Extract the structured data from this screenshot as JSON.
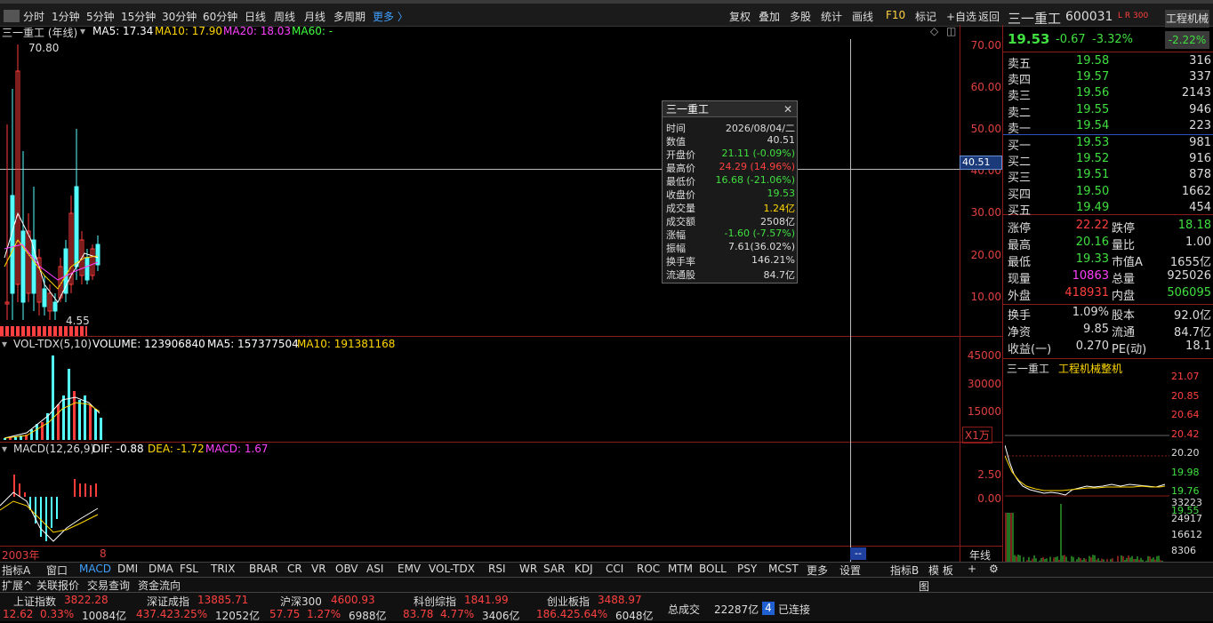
{
  "menu": {
    "periods": [
      "分时",
      "1分钟",
      "5分钟",
      "15分钟",
      "30分钟",
      "60分钟",
      "日线",
      "周线",
      "月线",
      "多周期",
      "更多 〉"
    ],
    "actions": [
      "复权",
      "叠加",
      "多股",
      "统计",
      "画线",
      "F10",
      "标记",
      "+自选",
      "返回"
    ]
  },
  "chart": {
    "title": "三一重工 (年线)",
    "ma_legend": [
      {
        "label": "MA5: 17.34",
        "color": "#ffffff"
      },
      {
        "label": "MA10: 17.90",
        "color": "#ffd700"
      },
      {
        "label": "MA20: 18.03",
        "color": "#ff40ff"
      },
      {
        "label": "MA60: -",
        "color": "#40ff40"
      }
    ],
    "high_label": "70.80",
    "low_label": "4.55",
    "y_ticks": [
      "70.00",
      "60.00",
      "50.00",
      "40.00",
      "30.00",
      "20.00",
      "10.00"
    ],
    "crosshair_value": "40.51",
    "vol_legend": {
      "name": "VOL-TDX(5,10)",
      "volume": "VOLUME: 123906840",
      "ma5": "MA5: 157377504",
      "ma10": "MA10: 191381168"
    },
    "vol_ticks": [
      "45000",
      "30000",
      "15000"
    ],
    "vol_unit": "X1万",
    "macd_legend": {
      "name": "MACD(12,26,9)",
      "dif": "DIF: -0.88",
      "dea": "DEA: -1.72",
      "macd": "MACD: 1.67"
    },
    "macd_ticks": [
      "2.50",
      "0.00"
    ],
    "x_start": "2003年",
    "x_mark": "8",
    "period_label": "年线",
    "cursor_box": "--",
    "colors": {
      "up": "#ff3c3c",
      "down": "#54ffff",
      "grid": "#8b1a1a"
    }
  },
  "tooltip": {
    "title": "三一重工",
    "rows": [
      {
        "k": "时间",
        "v": "2026/08/04/二",
        "c": "#dddddd"
      },
      {
        "k": "数值",
        "v": "40.51",
        "c": "#dddddd"
      },
      {
        "k": "开盘价",
        "v": "21.11 (-0.09%)",
        "c": "#40e040"
      },
      {
        "k": "最高价",
        "v": "24.29 (14.96%)",
        "c": "#ff4040"
      },
      {
        "k": "最低价",
        "v": "16.68 (-21.06%)",
        "c": "#40e040"
      },
      {
        "k": "收盘价",
        "v": "19.53",
        "c": "#40e040"
      },
      {
        "k": "成交量",
        "v": "1.24亿",
        "c": "#ffd700"
      },
      {
        "k": "成交额",
        "v": "2508亿",
        "c": "#dddddd"
      },
      {
        "k": "涨幅",
        "v": "-1.60 (-7.57%)",
        "c": "#40e040"
      },
      {
        "k": "振幅",
        "v": "7.61(36.02%)",
        "c": "#dddddd"
      },
      {
        "k": "换手率",
        "v": "146.21%",
        "c": "#dddddd"
      },
      {
        "k": "流通股",
        "v": "84.7亿",
        "c": "#dddddd"
      }
    ]
  },
  "quote": {
    "name": "三一重工",
    "code": "600031",
    "tag": "L R 300",
    "sector": "工程机械",
    "sector_chg": "-2.22%",
    "price": "19.53",
    "chg": "-0.67",
    "pct": "-3.32%",
    "asks": [
      {
        "l": "卖五",
        "p": "19.58",
        "q": "316"
      },
      {
        "l": "卖四",
        "p": "19.57",
        "q": "337"
      },
      {
        "l": "卖三",
        "p": "19.56",
        "q": "2143"
      },
      {
        "l": "卖二",
        "p": "19.55",
        "q": "946"
      },
      {
        "l": "卖一",
        "p": "19.54",
        "q": "223"
      }
    ],
    "bids": [
      {
        "l": "买一",
        "p": "19.53",
        "q": "981"
      },
      {
        "l": "买二",
        "p": "19.52",
        "q": "916"
      },
      {
        "l": "买三",
        "p": "19.51",
        "q": "878"
      },
      {
        "l": "买四",
        "p": "19.50",
        "q": "1662"
      },
      {
        "l": "买五",
        "p": "19.49",
        "q": "454"
      }
    ],
    "stats": [
      {
        "a": "涨停",
        "av": "22.22",
        "ac": "#ff4040",
        "b": "跌停",
        "bv": "18.18",
        "bc": "#40e040"
      },
      {
        "a": "最高",
        "av": "20.16",
        "ac": "#40e040",
        "b": "量比",
        "bv": "1.00",
        "bc": "#dddddd"
      },
      {
        "a": "最低",
        "av": "19.33",
        "ac": "#40e040",
        "b": "市值A",
        "bv": "1655亿",
        "bc": "#dddddd"
      },
      {
        "a": "现量",
        "av": "10863",
        "ac": "#ff40ff",
        "b": "总量",
        "bv": "925026",
        "bc": "#dddddd"
      },
      {
        "a": "外盘",
        "av": "418931",
        "ac": "#ff4040",
        "b": "内盘",
        "bv": "506095",
        "bc": "#40e040"
      }
    ],
    "fund": [
      {
        "a": "换手",
        "av": "1.09%",
        "b": "股本",
        "bv": "92.0亿"
      },
      {
        "a": "净资",
        "av": "9.85",
        "b": "流通",
        "bv": "84.7亿"
      },
      {
        "a": "收益(一)",
        "av": "0.270",
        "b": "PE(动)",
        "bv": "18.1"
      }
    ],
    "mini_title": "三一重工",
    "mini_sector": "工程机械整机",
    "mini_ticks": [
      "21.07",
      "20.85",
      "20.64",
      "20.42",
      "20.20",
      "19.98",
      "19.76",
      "19.55"
    ],
    "mini_vol_ticks": [
      "33223",
      "24917",
      "16612",
      "8306"
    ]
  },
  "tabs": [
    "指标A",
    "窗口",
    "MACD",
    "DMI",
    "DMA",
    "FSL",
    "TRIX",
    "BRAR",
    "CR",
    "VR",
    "OBV",
    "ASI",
    "EMV",
    "VOL-TDX",
    "RSI",
    "WR",
    "SAR",
    "KDJ",
    "CCI",
    "ROC",
    "MTM",
    "BOLL",
    "PSY",
    "MCST",
    "更多",
    "设置"
  ],
  "tabs_right": [
    "指标B",
    "模 板",
    "+",
    "⚙"
  ],
  "bottom_tabs": [
    "扩展^",
    "关联报价",
    "交易查询",
    "资金流向"
  ],
  "indices": [
    {
      "name": "上证指数",
      "val": "3822.28",
      "chg": "12.62",
      "pct": "0.33%",
      "amt": "10084亿"
    },
    {
      "name": "深证成指",
      "val": "13885.71",
      "chg": "437.42",
      "pct": "3.25%",
      "amt": "12052亿"
    },
    {
      "name": "沪深300",
      "val": "4600.93",
      "chg": "57.75",
      "pct": "1.27%",
      "amt": "6988亿"
    },
    {
      "name": "科创综指",
      "val": "1841.99",
      "chg": "83.78",
      "pct": "4.77%",
      "amt": "3406亿"
    },
    {
      "name": "创业板指",
      "val": "3488.97",
      "chg": "186.42",
      "pct": "5.64%",
      "amt": "6048亿"
    }
  ],
  "total": {
    "label": "总成交",
    "val": "22287亿",
    "conn_num": "4",
    "conn": "已连接"
  },
  "right_footer": "图"
}
